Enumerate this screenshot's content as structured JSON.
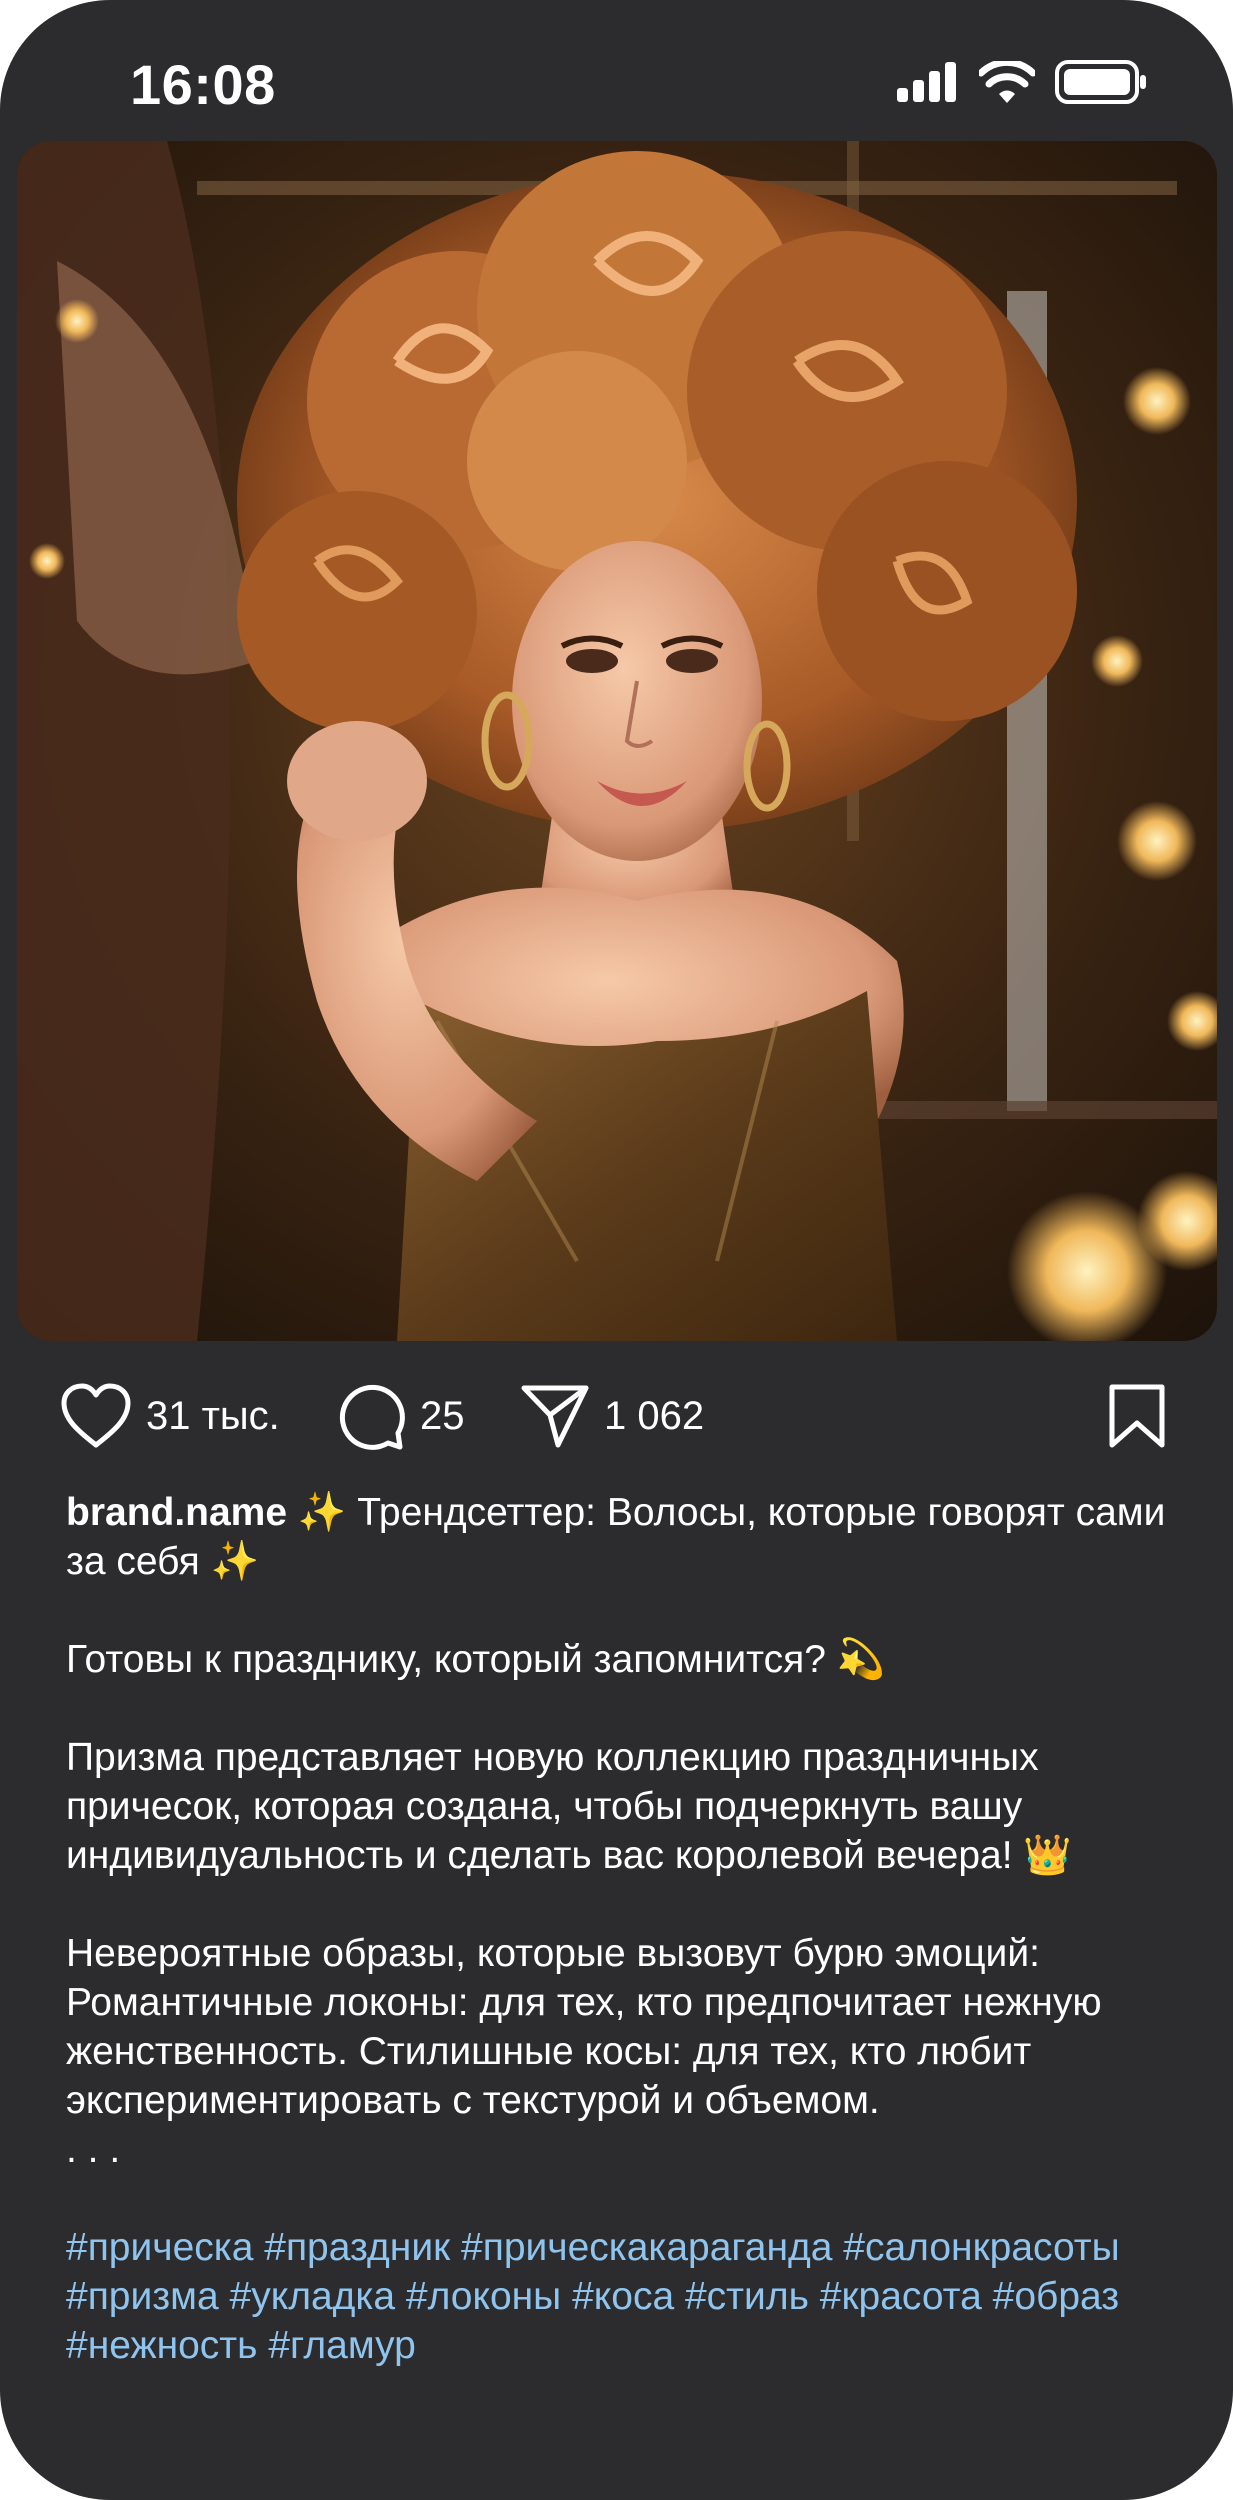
{
  "status_bar": {
    "time": "16:08",
    "icons": [
      "cellular-signal-icon",
      "wifi-icon",
      "battery-icon"
    ]
  },
  "post": {
    "image_icon": "photo-woman-voluminous-red-curls",
    "actions": {
      "likes": "31 тыс.",
      "comments": "25",
      "shares": "1 062"
    },
    "icons": {
      "like": "heart-icon",
      "comment": "comment-bubble-icon",
      "share": "send-icon",
      "save": "bookmark-icon"
    },
    "caption": {
      "username": "brand.name",
      "headline": "✨ Трендсеттер: Волосы, которые говорят сами за себя ✨",
      "question": "Готовы к празднику, который запомнится? 💫",
      "paragraph1": "Призма представляет новую коллекцию праздничных причесок, которая создана, чтобы подчеркнуть вашу индивидуальность и сделать вас королевой вечера! 👑",
      "paragraph2": "Невероятные образы, которые вызовут бурю эмоций: Романтичные локоны: для тех, кто предпочитает нежную женственность. Стилишные косы: для тех, кто любит экспериментировать с текстурой и объемом.",
      "ellipsis": ". . .",
      "hashtags": [
        "#прическа",
        "#праздник",
        "#прическакараганда",
        "#салонкрасоты",
        "#призма",
        "#укладка",
        "#локоны",
        "#коса",
        "#стиль",
        "#красота",
        "#образ",
        "#нежность",
        "#гламур"
      ]
    },
    "colors": {
      "background": "#2c2c2e",
      "text": "#ffffff",
      "hashtag": "#8fc4ee"
    }
  }
}
